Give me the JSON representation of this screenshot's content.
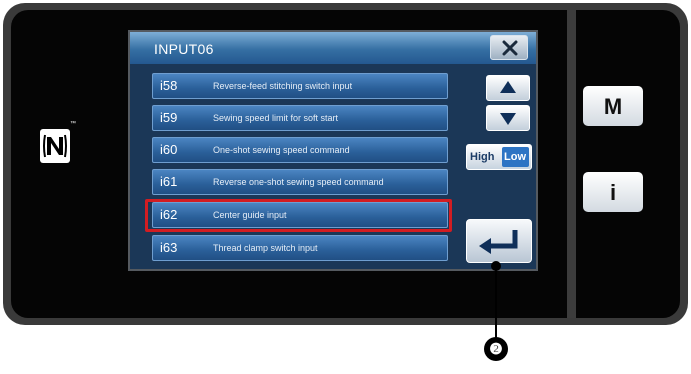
{
  "window": {
    "title": "INPUT06",
    "close_icon": "close-x-icon"
  },
  "rows": [
    {
      "num": "i58",
      "label": "Reverse-feed stitching switch input"
    },
    {
      "num": "i59",
      "label": "Sewing speed limit for soft start"
    },
    {
      "num": "i60",
      "label": "One-shot sewing speed command"
    },
    {
      "num": "i61",
      "label": "Reverse one-shot sewing speed command"
    },
    {
      "num": "i62",
      "label": "Center guide input"
    },
    {
      "num": "i63",
      "label": "Thread clamp switch input"
    }
  ],
  "selected_row": "i62",
  "controls": {
    "scroll_up_icon": "triangle-up-icon",
    "scroll_down_icon": "triangle-down-icon",
    "high_label": "High",
    "low_label": "Low",
    "enter_icon": "enter-arrow-icon"
  },
  "side_buttons": {
    "mode_label": "M",
    "info_label": "i"
  },
  "callout": {
    "number": "❷"
  },
  "colors": {
    "titlebar": "#356fa3",
    "row": "#2a5f99",
    "highlight": "#d21d22",
    "low_active": "#2d74c4"
  }
}
